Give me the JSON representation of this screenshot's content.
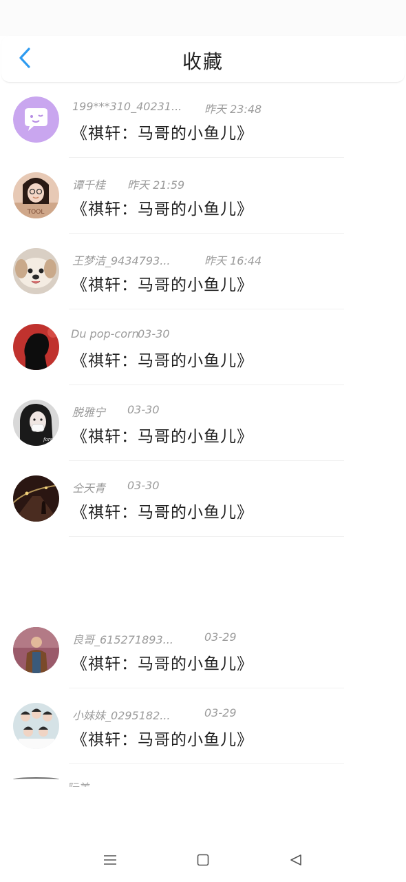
{
  "header": {
    "title": "收藏",
    "back_icon": "chevron-left-icon"
  },
  "items": [
    {
      "name": "199***310_40231...",
      "time": "昨天 23:48",
      "title": "《祺轩：马哥的小鱼儿》",
      "avatar": "chat-bubble-face"
    },
    {
      "name": "谭千桂",
      "time": "昨天 21:59",
      "title": "《祺轩：马哥的小鱼儿》",
      "avatar": "girl-photo"
    },
    {
      "name": "王梦洁_9434793...",
      "time": "昨天 16:44",
      "title": "《祺轩：马哥的小鱼儿》",
      "avatar": "dog-photo"
    },
    {
      "name": "Du pop-corn",
      "time": "03-30",
      "title": "《祺轩：马哥的小鱼儿》",
      "avatar": "silhouette-photo"
    },
    {
      "name": "脱雅宁",
      "time": "03-30",
      "title": "《祺轩：马哥的小鱼儿》",
      "avatar": "masked-girl-photo"
    },
    {
      "name": "仝天青",
      "time": "03-30",
      "title": "《祺轩：马哥的小鱼儿》",
      "avatar": "night-road-photo"
    },
    {
      "name": "良哥_615271893...",
      "time": "03-29",
      "title": "《祺轩：马哥的小鱼儿》",
      "avatar": "man-photo"
    },
    {
      "name": "小妹妹_0295182...",
      "time": "03-29",
      "title": "《祺轩：马哥的小鱼儿》",
      "avatar": "group-photo"
    }
  ],
  "partial_row": {
    "name": "阮美..."
  },
  "navbar": {
    "menu_icon": "menu-icon",
    "home_icon": "square-home-icon",
    "back_icon": "triangle-back-icon"
  },
  "colors": {
    "accent": "#2e9bf0",
    "text_primary": "#1e1e1e",
    "text_secondary": "#9b9b9b"
  }
}
